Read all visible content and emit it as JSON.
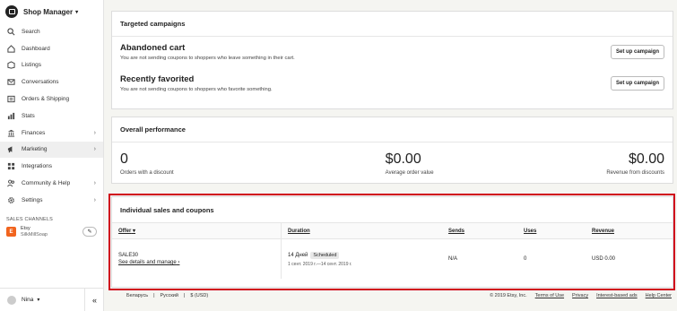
{
  "sidebar": {
    "brand": "Shop Manager",
    "items": [
      {
        "label": "Search",
        "icon": "search-icon"
      },
      {
        "label": "Dashboard",
        "icon": "home-icon"
      },
      {
        "label": "Listings",
        "icon": "listings-icon"
      },
      {
        "label": "Conversations",
        "icon": "mail-icon"
      },
      {
        "label": "Orders & Shipping",
        "icon": "orders-icon"
      },
      {
        "label": "Stats",
        "icon": "stats-icon"
      },
      {
        "label": "Finances",
        "icon": "finances-icon",
        "arrow": true
      },
      {
        "label": "Marketing",
        "icon": "megaphone-icon",
        "arrow": true,
        "active": true
      },
      {
        "label": "Integrations",
        "icon": "grid-icon"
      },
      {
        "label": "Community & Help",
        "icon": "people-icon",
        "arrow": true
      },
      {
        "label": "Settings",
        "icon": "gear-icon",
        "arrow": true
      }
    ],
    "channels_label": "SALES CHANNELS",
    "channel_name": "Etsy",
    "channel_shop": "SilkMillSoap",
    "channel_logo_letter": "E",
    "user_name": "Nina"
  },
  "targeted": {
    "title": "Targeted campaigns",
    "campaigns": [
      {
        "name": "Abandoned cart",
        "desc": "You are not sending coupons to shoppers who leave something in their cart.",
        "button": "Set up campaign"
      },
      {
        "name": "Recently favorited",
        "desc": "You are not sending coupons to shoppers who favorite something.",
        "button": "Set up campaign"
      }
    ]
  },
  "performance": {
    "title": "Overall performance",
    "stats": [
      {
        "value": "0",
        "label": "Orders with a discount"
      },
      {
        "value": "$0.00",
        "label": "Average order value"
      },
      {
        "value": "$0.00",
        "label": "Revenue from discounts"
      }
    ]
  },
  "individual": {
    "title": "Individual sales and coupons",
    "headers": {
      "offer": "Offer",
      "duration": "Duration",
      "sends": "Sends",
      "uses": "Uses",
      "revenue": "Revenue"
    },
    "row": {
      "code": "SALE30",
      "link": "See details and manage",
      "duration": "14 Дней",
      "status": "Scheduled",
      "dates": "1 сент. 2019 г.—14 сент. 2019 г.",
      "sends": "N/A",
      "uses": "0",
      "revenue": "USD 0.00"
    }
  },
  "footer": {
    "region": "Беларусь",
    "language": "Русский",
    "currency": "$ (USD)",
    "copyright": "© 2019 Etsy, Inc.",
    "terms": "Terms of Use",
    "privacy": "Privacy",
    "ads": "Interest-based ads",
    "help": "Help Center"
  }
}
